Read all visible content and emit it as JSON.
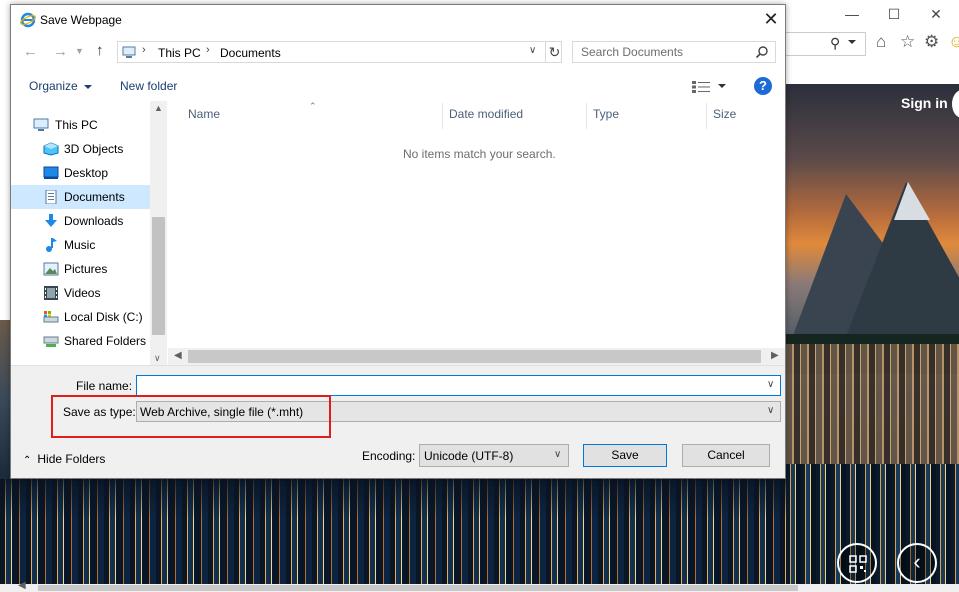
{
  "browser": {
    "signin_label": "Sign in"
  },
  "dialog": {
    "title": "Save Webpage",
    "breadcrumb": [
      "This PC",
      "Documents"
    ],
    "search": {
      "placeholder": "Search Documents"
    },
    "commands": {
      "organize": "Organize",
      "new_folder": "New folder"
    },
    "nav_items": [
      {
        "label": "This PC",
        "icon": "computer-icon"
      },
      {
        "label": "3D Objects",
        "icon": "3d-objects-icon"
      },
      {
        "label": "Desktop",
        "icon": "desktop-icon"
      },
      {
        "label": "Documents",
        "icon": "documents-icon",
        "selected": true
      },
      {
        "label": "Downloads",
        "icon": "downloads-icon"
      },
      {
        "label": "Music",
        "icon": "music-icon"
      },
      {
        "label": "Pictures",
        "icon": "pictures-icon"
      },
      {
        "label": "Videos",
        "icon": "videos-icon"
      },
      {
        "label": "Local Disk (C:)",
        "icon": "local-disk-icon"
      },
      {
        "label": "Shared Folders (",
        "icon": "shared-folder-icon"
      }
    ],
    "columns": [
      "Name",
      "Date modified",
      "Type",
      "Size"
    ],
    "empty_message": "No items match your search.",
    "filename": {
      "label": "File name:",
      "value": ""
    },
    "save_as_type": {
      "label": "Save as type:",
      "value": "Web Archive, single file (*.mht)"
    },
    "hide_folders": "Hide Folders",
    "encoding": {
      "label": "Encoding:",
      "value": "Unicode (UTF-8)"
    },
    "buttons": {
      "save": "Save",
      "cancel": "Cancel"
    },
    "colors": {
      "highlight": "#e01c1c",
      "selected_nav": "#cde8ff",
      "accent": "#0078d7"
    }
  }
}
